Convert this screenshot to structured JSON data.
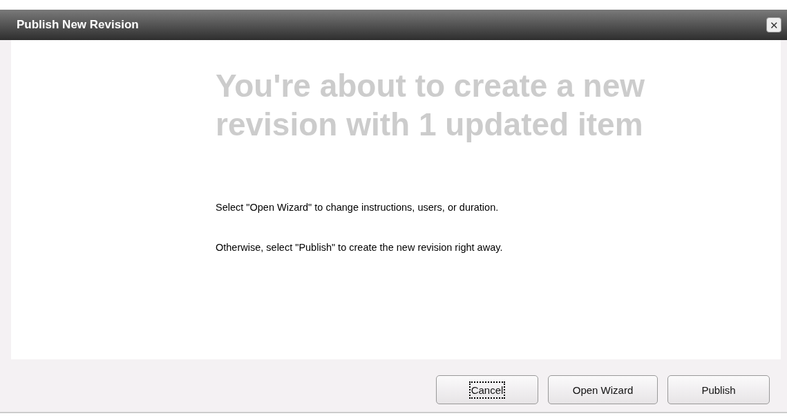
{
  "window": {
    "title": "Publish New Revision",
    "close": "✕"
  },
  "heading": "You're about to create a new revision with 1 updated item",
  "paragraphs": [
    "Select \"Open Wizard\" to change instructions, users, or duration.",
    "Otherwise, select \"Publish\" to create the new revision right away."
  ],
  "buttons": [
    {
      "label": "Cancel",
      "focused": true
    },
    {
      "label": "Open Wizard",
      "focused": false
    },
    {
      "label": "Publish",
      "focused": false
    }
  ]
}
